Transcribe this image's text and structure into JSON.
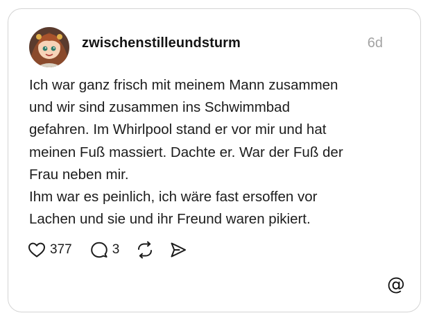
{
  "post": {
    "username": "zwischenstilleundsturm",
    "time_ago": "6d",
    "paragraphs": [
      "Ich war ganz frisch mit meinem Mann zusammen\nund wir sind zusammen ins Schwimmbad\ngefahren. Im Whirlpool stand er vor mir und hat\nmeinen Fuß massiert. Dachte er. War der Fuß der\nFrau neben mir.",
      "Ihm war es peinlich, ich wäre fast ersoffen vor\nLachen und sie und ihr Freund waren pikiert."
    ]
  },
  "actions": {
    "likes": "377",
    "replies": "3"
  },
  "icons": {
    "like": "heart-icon",
    "reply": "comment-bubble-icon",
    "repost": "repost-icon",
    "share": "send-icon",
    "logo": "threads-logo-icon"
  },
  "logo_glyph": "@"
}
